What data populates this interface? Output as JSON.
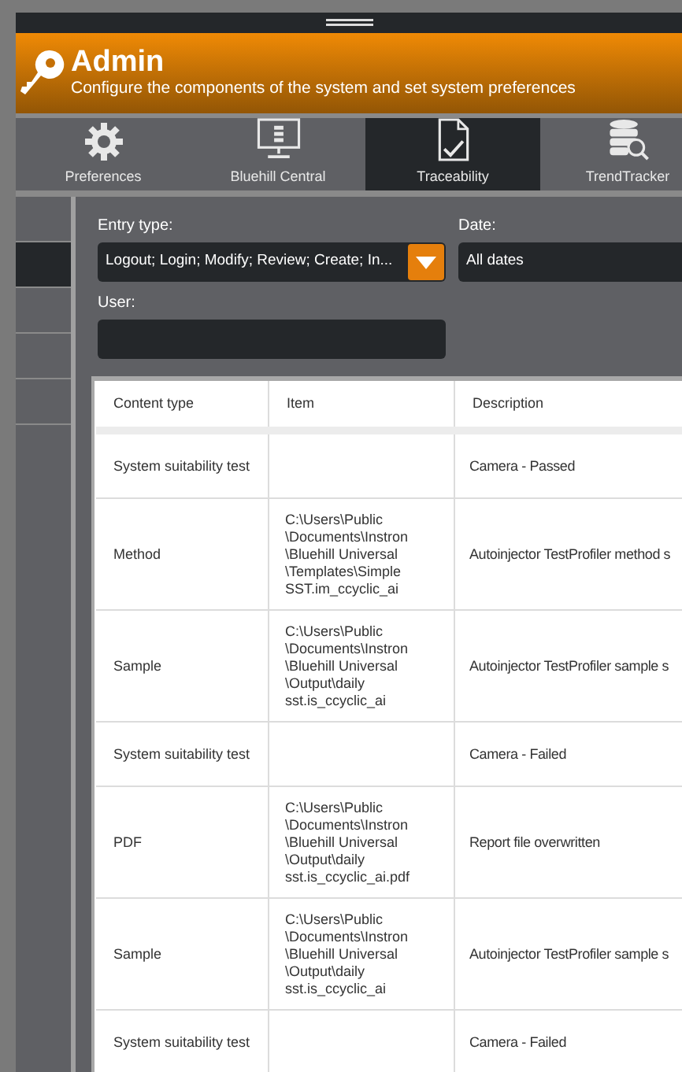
{
  "header": {
    "title": "Admin",
    "subtitle": "Configure the components of the system and set system preferences"
  },
  "tabs": [
    {
      "label": "Preferences",
      "kind": "gear",
      "selected": false
    },
    {
      "label": "Bluehill Central",
      "kind": "monitor",
      "selected": false
    },
    {
      "label": "Traceability",
      "kind": "document",
      "selected": true
    },
    {
      "label": "TrendTracker",
      "kind": "database",
      "selected": false
    }
  ],
  "sidebar": {
    "items": [
      {
        "selected": false
      },
      {
        "selected": true
      },
      {
        "selected": false
      },
      {
        "selected": false
      },
      {
        "selected": false
      }
    ]
  },
  "filters": {
    "entry_type": {
      "label": "Entry type:",
      "value": "Logout; Login; Modify; Review; Create; In..."
    },
    "date": {
      "label": "Date:",
      "value": "All dates"
    },
    "user": {
      "label": "User:"
    }
  },
  "table": {
    "columns": [
      "Content type",
      "Item",
      "Description"
    ],
    "rows": [
      [
        "System suitability test",
        "",
        "Camera - Passed"
      ],
      [
        "Method",
        "C:\\Users\\Public\n\\Documents\\Instron\n\\Bluehill Universal\n\\Templates\\Simple\nSST.im_ccyclic_ai",
        "Autoinjector TestProfiler method s"
      ],
      [
        "Sample",
        "C:\\Users\\Public\n\\Documents\\Instron\n\\Bluehill Universal\n\\Output\\daily\nsst.is_ccyclic_ai",
        "Autoinjector TestProfiler sample s"
      ],
      [
        "System suitability test",
        "",
        "Camera - Failed"
      ],
      [
        "PDF",
        "C:\\Users\\Public\n\\Documents\\Instron\n\\Bluehill Universal\n\\Output\\daily\nsst.is_ccyclic_ai.pdf",
        "Report file overwritten"
      ],
      [
        "Sample",
        "C:\\Users\\Public\n\\Documents\\Instron\n\\Bluehill Universal\n\\Output\\daily\nsst.is_ccyclic_ai",
        "Autoinjector TestProfiler sample s"
      ],
      [
        "System suitability test",
        "",
        "Camera - Failed"
      ]
    ]
  }
}
